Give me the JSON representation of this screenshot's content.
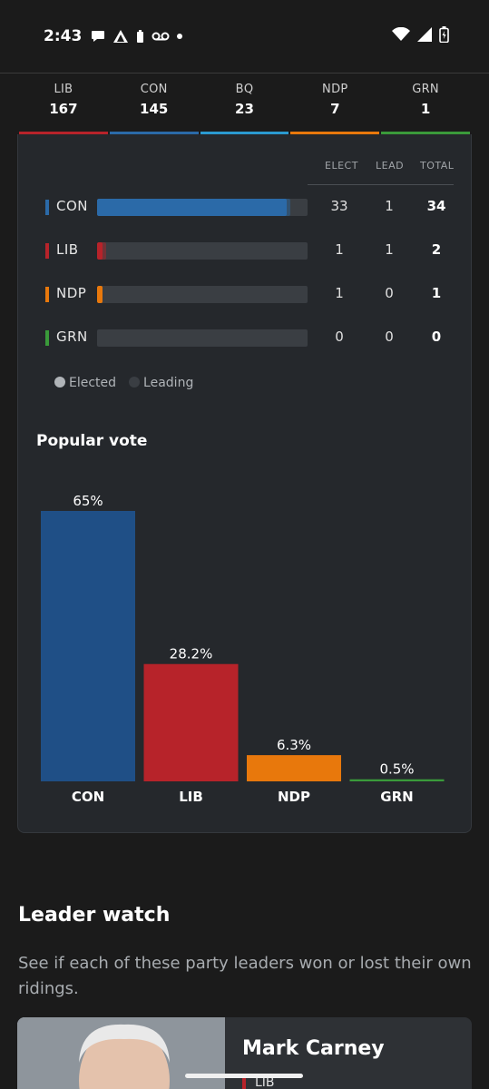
{
  "status_bar": {
    "time": "2:43",
    "icons": [
      "chat-icon",
      "triangle-icon",
      "battery-small-icon",
      "voicemail-icon",
      "dot-icon"
    ],
    "right_icons": [
      "wifi-icon",
      "signal-icon",
      "battery-icon"
    ]
  },
  "seat_tally": [
    {
      "party": "LIB",
      "seats": "167",
      "color": "#b7232a"
    },
    {
      "party": "CON",
      "seats": "145",
      "color": "#2b6aa8"
    },
    {
      "party": "BQ",
      "seats": "23",
      "color": "#2b9ad0"
    },
    {
      "party": "NDP",
      "seats": "7",
      "color": "#e8780c"
    },
    {
      "party": "GRN",
      "seats": "1",
      "color": "#3a9a3a"
    }
  ],
  "results_table": {
    "headers": {
      "elect": "ELECT",
      "lead": "LEAD",
      "total": "TOTAL"
    },
    "rows": [
      {
        "party": "CON",
        "elect": "33",
        "lead": "1",
        "total": "34",
        "color": "#2b6aa8",
        "elect_share": 0.9,
        "lead_share": 0.018
      },
      {
        "party": "LIB",
        "elect": "1",
        "lead": "1",
        "total": "2",
        "color": "#b7232a",
        "elect_share": 0.027,
        "lead_share": 0.018
      },
      {
        "party": "NDP",
        "elect": "1",
        "lead": "0",
        "total": "1",
        "color": "#e8780c",
        "elect_share": 0.027,
        "lead_share": 0
      },
      {
        "party": "GRN",
        "elect": "0",
        "lead": "0",
        "total": "0",
        "color": "#3a9a3a",
        "elect_share": 0,
        "lead_share": 0
      }
    ]
  },
  "legend": {
    "elected": "Elected",
    "leading": "Leading"
  },
  "popular_vote": {
    "title": "Popular vote"
  },
  "chart_data": {
    "type": "bar",
    "categories": [
      "CON",
      "LIB",
      "NDP",
      "GRN"
    ],
    "values": [
      65,
      28.2,
      6.3,
      0.5
    ],
    "labels": [
      "65%",
      "28.2%",
      "6.3%",
      "0.5%"
    ],
    "colors": [
      "#1f4f86",
      "#b7232a",
      "#e8780c",
      "#3a9a3a"
    ],
    "ylim": [
      0,
      65
    ],
    "grid": false
  },
  "leader_watch": {
    "title": "Leader watch",
    "description": "See if each of these party leaders won or lost their own ridings.",
    "leader": {
      "name": "Mark Carney",
      "party": "LIB"
    }
  }
}
